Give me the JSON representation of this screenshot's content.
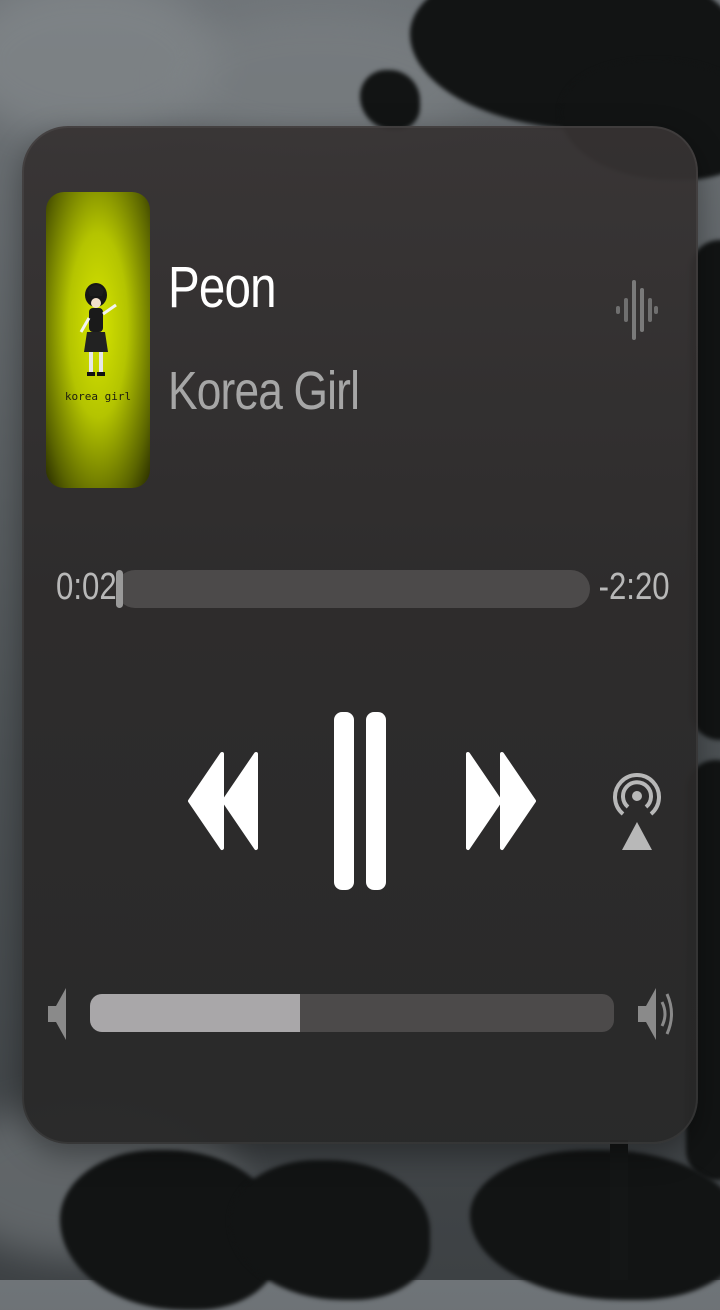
{
  "track": {
    "title": "Peon",
    "artist": "Korea Girl",
    "artwork_caption": "korea girl"
  },
  "playback": {
    "elapsed": "0:02",
    "remaining": "-2:20",
    "progress": 0.014,
    "state": "playing"
  },
  "controls": {
    "rewind_icon": "rewind-icon",
    "pause_icon": "pause-icon",
    "forward_icon": "fast-forward-icon",
    "airplay_icon": "airplay-icon"
  },
  "volume": {
    "level": 0.4,
    "low_icon": "speaker-low-icon",
    "high_icon": "speaker-high-icon"
  },
  "colors": {
    "artwork_accent": "#c8d600",
    "text_primary": "#ffffff",
    "text_secondary": "#a6a6a6"
  }
}
